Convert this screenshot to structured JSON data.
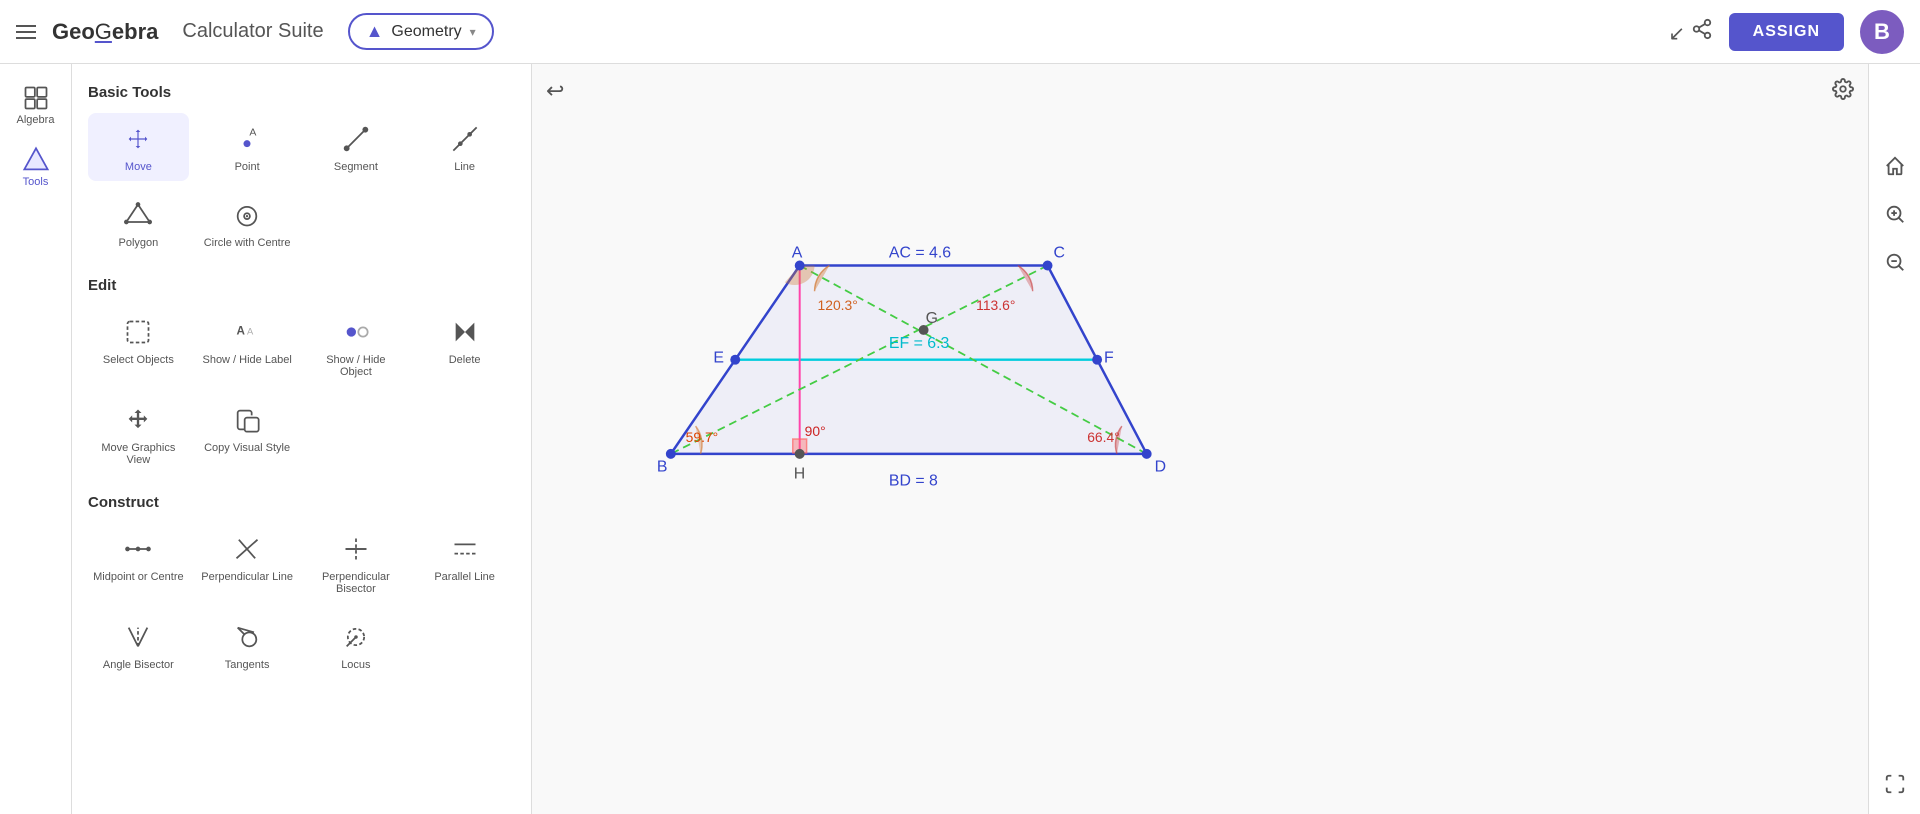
{
  "topbar": {
    "menu_label": "menu",
    "logo": "GeoGebra",
    "suite_name": "Calculator Suite",
    "geometry_label": "Geometry",
    "assign_label": "ASSIGN",
    "user_initial": "B"
  },
  "left_sidebar": {
    "items": [
      {
        "id": "algebra",
        "label": "Algebra",
        "active": false
      },
      {
        "id": "tools",
        "label": "Tools",
        "active": true
      }
    ]
  },
  "tools_panel": {
    "basic_tools_title": "Basic Tools",
    "edit_title": "Edit",
    "construct_title": "Construct",
    "basic_tools": [
      {
        "id": "move",
        "label": "Move",
        "active": true
      },
      {
        "id": "point",
        "label": "Point",
        "active": false
      },
      {
        "id": "segment",
        "label": "Segment",
        "active": false
      },
      {
        "id": "line",
        "label": "Line",
        "active": false
      },
      {
        "id": "polygon",
        "label": "Polygon",
        "active": false
      },
      {
        "id": "circle-centre",
        "label": "Circle with Centre",
        "active": false
      }
    ],
    "edit_tools": [
      {
        "id": "select-objects",
        "label": "Select Objects",
        "active": false
      },
      {
        "id": "show-hide-label",
        "label": "Show / Hide Label",
        "active": false
      },
      {
        "id": "show-hide-object",
        "label": "Show / Hide Object",
        "active": false
      },
      {
        "id": "delete",
        "label": "Delete",
        "active": false
      },
      {
        "id": "move-graphics",
        "label": "Move Graphics View",
        "active": false
      },
      {
        "id": "copy-visual",
        "label": "Copy Visual Style",
        "active": false
      }
    ],
    "construct_tools": [
      {
        "id": "midpoint",
        "label": "Midpoint or Centre",
        "active": false
      },
      {
        "id": "perp-line",
        "label": "Perpendicular Line",
        "active": false
      },
      {
        "id": "perp-bisector",
        "label": "Perpendicular Bisector",
        "active": false
      },
      {
        "id": "parallel-line",
        "label": "Parallel Line",
        "active": false
      },
      {
        "id": "angle-bisector",
        "label": "Angle Bisector",
        "active": false
      },
      {
        "id": "tangents",
        "label": "Tangents",
        "active": false
      },
      {
        "id": "locus",
        "label": "Locus",
        "active": false
      }
    ]
  },
  "geometry": {
    "label_AC": "AC = 4.6",
    "label_EF": "EF = 6.3",
    "label_BD": "BD = 8",
    "angle_A": "120.3°",
    "angle_C": "113.6°",
    "angle_B": "59.7°",
    "angle_H": "90°",
    "angle_D": "66.4°",
    "point_A": "A",
    "point_B": "B",
    "point_C": "C",
    "point_D": "D",
    "point_E": "E",
    "point_F": "F",
    "point_G": "G",
    "point_H": "H"
  },
  "right_sidebar": {
    "home_icon": "⌂",
    "zoom_in_icon": "+",
    "zoom_out_icon": "−",
    "fullscreen_icon": "⛶"
  }
}
